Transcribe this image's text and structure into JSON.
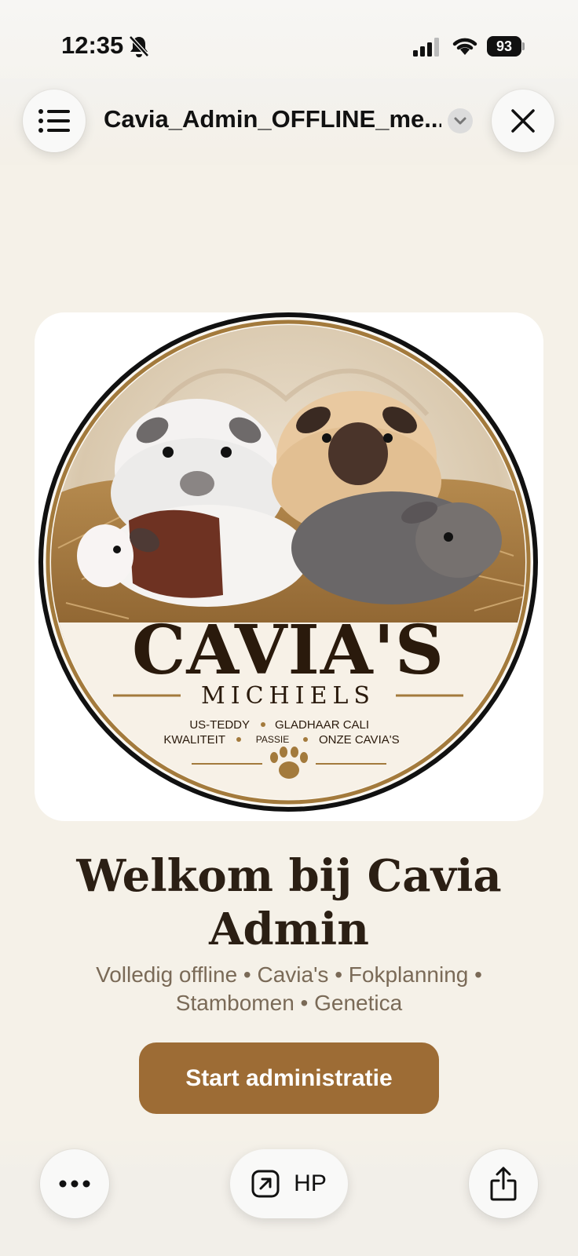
{
  "status_bar": {
    "time": "12:35",
    "battery": "93",
    "icons": [
      "bell-slash-icon",
      "signal-icon",
      "wifi-icon",
      "battery-icon"
    ]
  },
  "header": {
    "title": "Cavia_Admin_OFFLINE_me...",
    "menu_icon": "list-icon",
    "dropdown_icon": "chevron-down-icon",
    "close_icon": "close-icon"
  },
  "logo": {
    "brand": "CAVIA'S",
    "name": "MICHIELS",
    "line1_left": "US-TEDDY",
    "line1_right": "GLADHAAR CALI",
    "line2_left": "KWALITEIT",
    "line2_mid": "PASSIE",
    "line2_right": "ONZE CAVIA'S",
    "colors": {
      "gold": "#a37a3c",
      "dark": "#2a1a0c"
    }
  },
  "main": {
    "welcome_title": "Welkom bij Cavia Admin",
    "subtitle": "Volledig offline • Cavia's • Fokplanning • Stambomen • Genetica",
    "start_button": "Start administratie",
    "button_color": "#9d6c35"
  },
  "toolbar": {
    "more_icon": "more-icon",
    "hp_label": "HP",
    "hp_icon": "open-external-icon",
    "share_icon": "share-icon"
  }
}
